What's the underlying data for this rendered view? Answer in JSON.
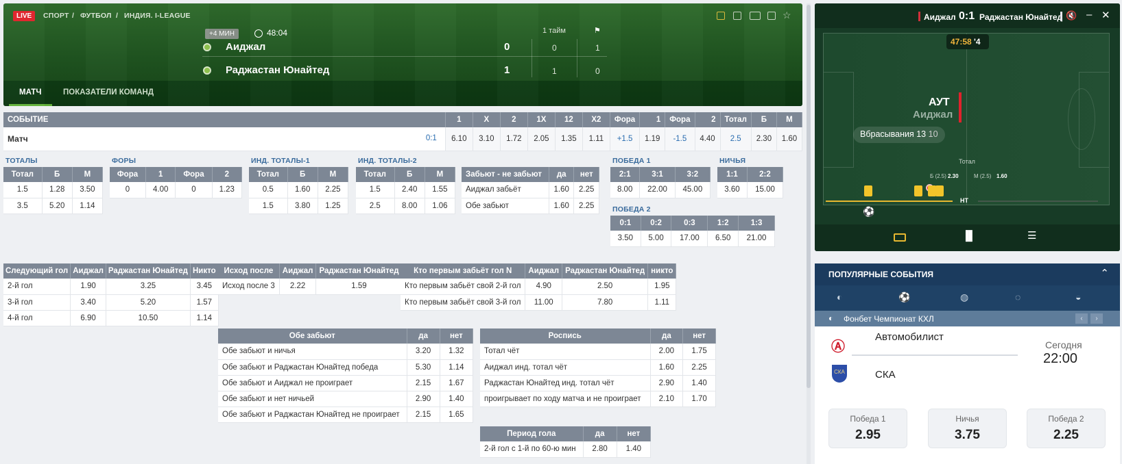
{
  "header": {
    "live": "LIVE",
    "breadcrumb": [
      "СПОРТ",
      "/",
      "ФУТБОЛ",
      "/",
      "ИНДИЯ. I-LEAGUE"
    ],
    "added_time": "+4 МИН",
    "clock": "48:04",
    "half_label": "1 тайм",
    "team1": {
      "name": "Аиджал",
      "score": "0",
      "half": "0",
      "corners": "1"
    },
    "team2": {
      "name": "Раджастан Юнайтед",
      "score": "1",
      "half": "1",
      "corners": "0"
    },
    "tabs": [
      "МАТЧ",
      "ПОКАЗАТЕЛИ КОМАНД"
    ]
  },
  "main": {
    "headers": [
      "СОБЫТИЕ",
      "1",
      "X",
      "2",
      "1X",
      "12",
      "X2",
      "Фора",
      "1",
      "Фора",
      "2",
      "Тотал",
      "Б",
      "М"
    ],
    "row": {
      "label": "Матч",
      "score": "0:1",
      "odds": [
        "6.10",
        "3.10",
        "1.72",
        "2.05",
        "1.35",
        "1.11",
        "+1.5",
        "1.19",
        "-1.5",
        "4.40",
        "2.5",
        "2.30",
        "1.60"
      ]
    }
  },
  "totals": {
    "title": "ТОТАЛЫ",
    "headers": [
      "Тотал",
      "Б",
      "М"
    ],
    "rows": [
      [
        "1.5",
        "1.28",
        "3.50"
      ],
      [
        "3.5",
        "5.20",
        "1.14"
      ]
    ]
  },
  "fory": {
    "title": "ФОРЫ",
    "headers": [
      "Фора",
      "1",
      "Фора",
      "2"
    ],
    "rows": [
      [
        "0",
        "4.00",
        "0",
        "1.23"
      ]
    ]
  },
  "ind1": {
    "title": "ИНД. ТОТАЛЫ-1",
    "headers": [
      "Тотал",
      "Б",
      "М"
    ],
    "rows": [
      [
        "0.5",
        "1.60",
        "2.25"
      ],
      [
        "1.5",
        "3.80",
        "1.25"
      ]
    ]
  },
  "ind2": {
    "title": "ИНД. ТОТАЛЫ-2",
    "headers": [
      "Тотал",
      "Б",
      "М"
    ],
    "rows": [
      [
        "1.5",
        "2.40",
        "1.55"
      ],
      [
        "2.5",
        "8.00",
        "1.06"
      ]
    ]
  },
  "zabyot": {
    "headers": [
      "Забьют - не забьют",
      "да",
      "нет"
    ],
    "rows": [
      [
        "Аиджал забьёт",
        "1.60",
        "2.25"
      ],
      [
        "Обе забьют",
        "1.60",
        "2.25"
      ]
    ]
  },
  "pobeda1": {
    "title": "ПОБЕДА 1",
    "headers": [
      "2:1",
      "3:1",
      "3:2"
    ],
    "rows": [
      [
        "8.00",
        "22.00",
        "45.00"
      ]
    ]
  },
  "nichya": {
    "title": "НИЧЬЯ",
    "headers": [
      "1:1",
      "2:2"
    ],
    "rows": [
      [
        "3.60",
        "15.00"
      ]
    ]
  },
  "pobeda2": {
    "title": "ПОБЕДА 2",
    "headers": [
      "0:1",
      "0:2",
      "0:3",
      "1:2",
      "1:3"
    ],
    "rows": [
      [
        "3.50",
        "5.00",
        "17.00",
        "6.50",
        "21.00"
      ]
    ]
  },
  "nextgoal": {
    "headers": [
      "Следующий гол",
      "Аиджал",
      "Раджастан Юнайтед",
      "Никто"
    ],
    "rows": [
      [
        "2-й гол",
        "1.90",
        "3.25",
        "3.45"
      ],
      [
        "3-й гол",
        "3.40",
        "5.20",
        "1.57"
      ],
      [
        "4-й гол",
        "6.90",
        "10.50",
        "1.14"
      ]
    ]
  },
  "ishod": {
    "headers": [
      "Исход после",
      "Аиджал",
      "Раджастан Юнайтед"
    ],
    "rows": [
      [
        "Исход после 3",
        "2.22",
        "1.59"
      ]
    ]
  },
  "firstgoal": {
    "headers": [
      "Кто первым забьёт гол N",
      "Аиджал",
      "Раджастан Юнайтед",
      "никто"
    ],
    "rows": [
      [
        "Кто первым забьёт свой 2-й гол",
        "4.90",
        "2.50",
        "1.95"
      ],
      [
        "Кто первым забьёт свой 3-й гол",
        "11.00",
        "7.80",
        "1.11"
      ]
    ]
  },
  "obe": {
    "headers": [
      "Обе забьют",
      "да",
      "нет"
    ],
    "rows": [
      [
        "Обе забьют и ничья",
        "3.20",
        "1.32"
      ],
      [
        "Обе забьют и Раджастан Юнайтед победа",
        "5.30",
        "1.14"
      ],
      [
        "Обе забьют и Аиджал не проиграет",
        "2.15",
        "1.67"
      ],
      [
        "Обе забьют и нет ничьей",
        "2.90",
        "1.40"
      ],
      [
        "Обе забьют и Раджастан Юнайтед не проиграет",
        "2.15",
        "1.65"
      ]
    ]
  },
  "rospis": {
    "headers": [
      "Роспись",
      "да",
      "нет"
    ],
    "rows": [
      [
        "Тотал чёт",
        "2.00",
        "1.75"
      ],
      [
        "Аиджал инд. тотал чёт",
        "1.60",
        "2.25"
      ],
      [
        "Раджастан Юнайтед инд. тотал чёт",
        "2.90",
        "1.40"
      ],
      [
        "проигрывает по ходу матча и не проиграет",
        "2.10",
        "1.70"
      ]
    ]
  },
  "period": {
    "headers": [
      "Период гола",
      "да",
      "нет"
    ],
    "rows": [
      [
        "2-й гол с 1-й по 60-ю мин",
        "2.80",
        "1.40"
      ]
    ]
  },
  "tracker": {
    "team1": "Аиджал",
    "score": "0:1",
    "team2": "Раджастан Юнайтед",
    "time": "47:58",
    "added": "'4",
    "event": "АУТ",
    "event_team": "Аиджал",
    "throwins_label": "Вбрасывания",
    "throwins_1": "13",
    "throwins_2": "10",
    "total_label": "Тотал",
    "b_label": "Б (2.5)",
    "b_val": "2.30",
    "m_label": "М (2.5)",
    "m_val": "1.60",
    "ht": "НТ"
  },
  "popular": {
    "title": "ПОПУЛЯРНЫЕ СОБЫТИЯ",
    "league": "Фонбет Чемпионат КХЛ",
    "team1": "Автомобилист",
    "team2": "СКА",
    "day": "Сегодня",
    "time": "22:00",
    "odds": [
      {
        "label": "Победа 1",
        "value": "2.95"
      },
      {
        "label": "Ничья",
        "value": "3.75"
      },
      {
        "label": "Победа 2",
        "value": "2.25"
      }
    ]
  }
}
